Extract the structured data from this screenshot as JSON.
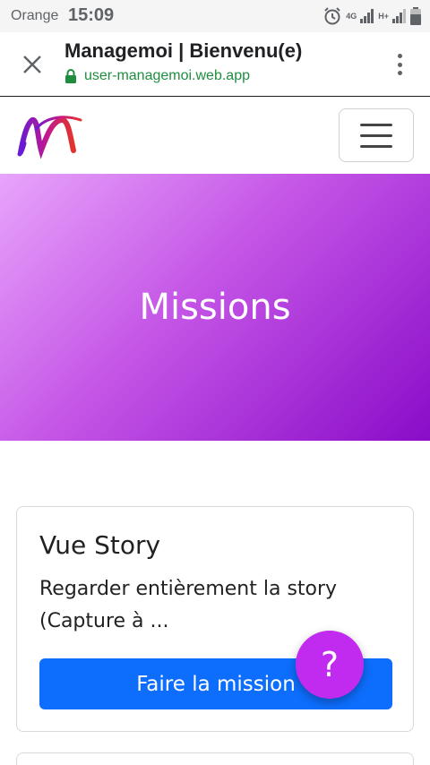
{
  "status_bar": {
    "carrier": "Orange",
    "time": "15:09",
    "network": "4G",
    "network2": "H+"
  },
  "browser": {
    "title": "Managemoi | Bienvenu(e)",
    "url": "user-managemoi.web.app"
  },
  "hero": {
    "title": "Missions"
  },
  "missions": [
    {
      "title": "Vue Story",
      "description": "Regarder entièrement la story (Capture à ...",
      "button_label": "Faire la mission"
    }
  ],
  "help_button": {
    "label": "?"
  },
  "colors": {
    "primary_button": "#0d6efd",
    "help_fab": "#c12bf0",
    "hero_gradient_start": "#e8a4fb",
    "hero_gradient_end": "#8a0cc8",
    "url_green": "#1e8e3e"
  }
}
